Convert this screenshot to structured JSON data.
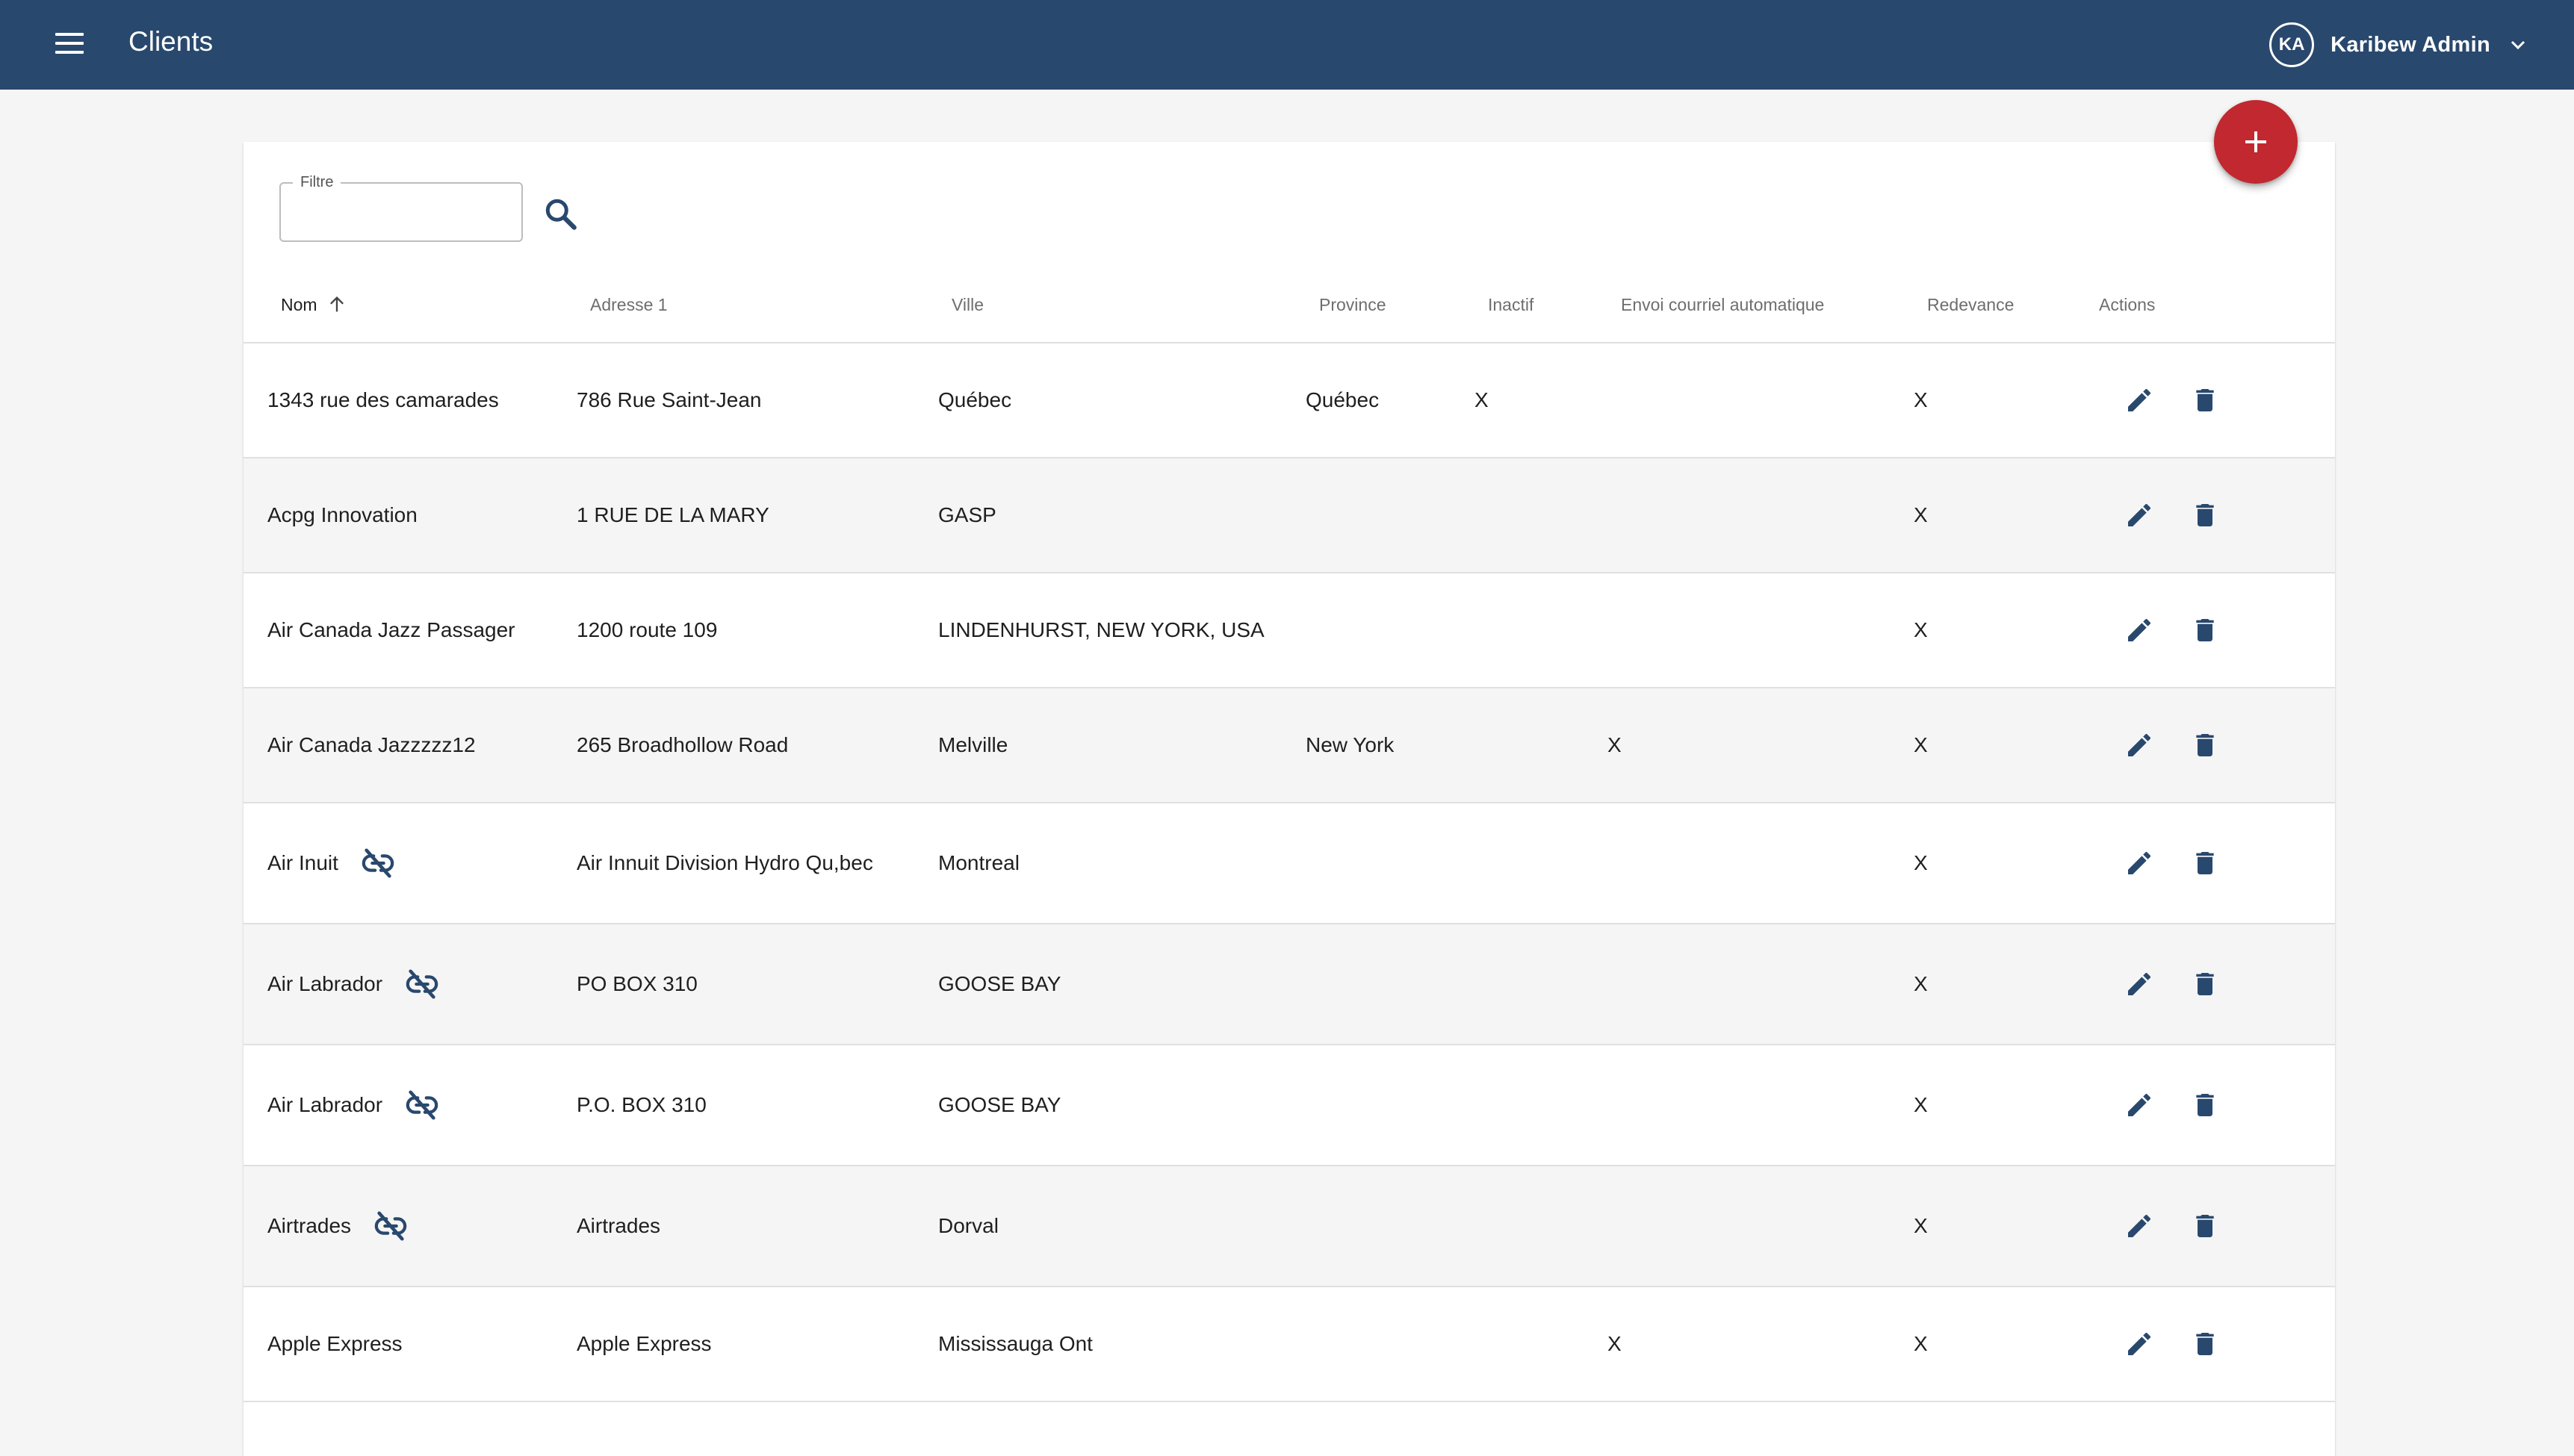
{
  "header": {
    "title": "Clients",
    "user": {
      "initials": "KA",
      "name": "Karibew Admin"
    }
  },
  "filter": {
    "label": "Filtre",
    "value": ""
  },
  "table": {
    "columns": [
      "Nom",
      "Adresse 1",
      "Ville",
      "Province",
      "Inactif",
      "Envoi courriel automatique",
      "Redevance",
      "Actions"
    ],
    "sorted_column": "Nom",
    "sort_direction": "ascending",
    "rows": [
      {
        "nom": "1343 rue des camarades",
        "adresse": "786 Rue Saint-Jean",
        "ville": "Québec",
        "province": "Québec",
        "inactif": "X",
        "envoi": "",
        "redevance": "X",
        "unlinked": false
      },
      {
        "nom": "Acpg Innovation",
        "adresse": "1 RUE DE LA MARY",
        "ville": "GASP",
        "province": "",
        "inactif": "",
        "envoi": "",
        "redevance": "X",
        "unlinked": false
      },
      {
        "nom": "Air Canada Jazz Passager",
        "adresse": "1200 route 109",
        "ville": "LINDENHURST, NEW YORK, USA",
        "province": "",
        "inactif": "",
        "envoi": "",
        "redevance": "X",
        "unlinked": false
      },
      {
        "nom": "Air Canada Jazzzzz12",
        "adresse": "265 Broadhollow Road",
        "ville": "Melville",
        "province": "New York",
        "inactif": "",
        "envoi": "X",
        "redevance": "X",
        "unlinked": false
      },
      {
        "nom": "Air Inuit",
        "adresse": "Air Innuit Division Hydro Qu,bec",
        "ville": "Montreal",
        "province": "",
        "inactif": "",
        "envoi": "",
        "redevance": "X",
        "unlinked": true
      },
      {
        "nom": "Air Labrador",
        "adresse": "PO BOX 310",
        "ville": "GOOSE BAY",
        "province": "",
        "inactif": "",
        "envoi": "",
        "redevance": "X",
        "unlinked": true
      },
      {
        "nom": "Air Labrador",
        "adresse": "P.O. BOX 310",
        "ville": "GOOSE BAY",
        "province": "",
        "inactif": "",
        "envoi": "",
        "redevance": "X",
        "unlinked": true
      },
      {
        "nom": "Airtrades",
        "adresse": "Airtrades",
        "ville": "Dorval",
        "province": "",
        "inactif": "",
        "envoi": "",
        "redevance": "X",
        "unlinked": true
      },
      {
        "nom": "Apple Express",
        "adresse": "Apple Express",
        "ville": "Mississauga Ont",
        "province": "",
        "inactif": "",
        "envoi": "X",
        "redevance": "X",
        "unlinked": false
      }
    ]
  },
  "icons": {
    "menu": "menu-icon",
    "search": "search-icon",
    "add": "plus-icon",
    "sort": "arrow-up-icon",
    "unlinked": "link-off-icon",
    "edit": "pencil-icon",
    "delete": "trash-icon",
    "account_menu": "chevron-down-icon"
  },
  "colors": {
    "app_bar": "#29486d",
    "fab": "#c1282f",
    "icon": "#29486d",
    "row_alt": "#f5f5f5"
  }
}
